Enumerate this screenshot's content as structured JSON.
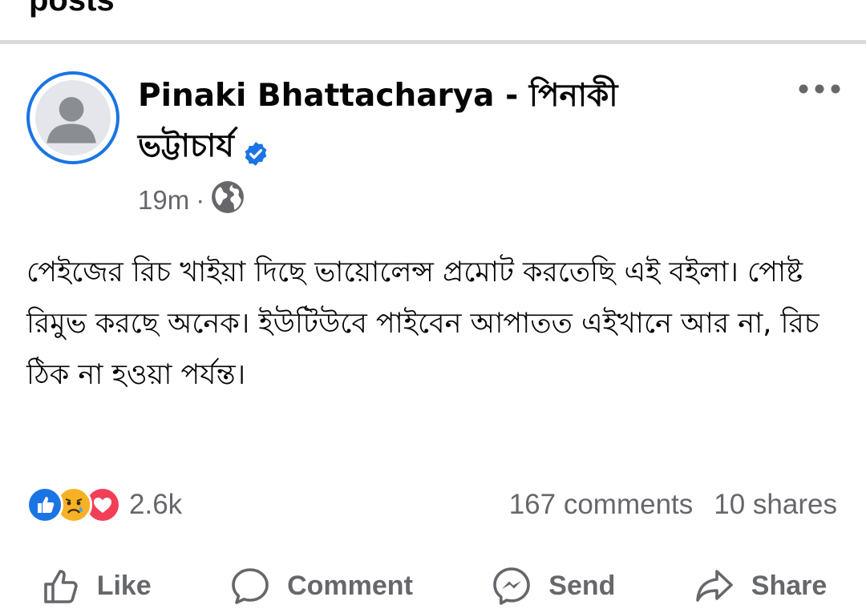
{
  "section": {
    "title": "posts"
  },
  "post": {
    "author": "Pinaki Bhattacharya - পিনাকী ভট্টাচার্য",
    "time": "19m",
    "separator": "·",
    "text": "পেইজের রিচ খাইয়া দিছে ভায়োলেন্স প্রমোট করতেছি এই বইলা। পোষ্ট রিমুভ করছে অনেক। ইউটিউবে পাইবেন আপাতত এইখানে আর না, রিচ ঠিক না হওয়া পর্যন্ত।",
    "reactions_count": "2.6k",
    "comments": "167 comments",
    "shares": "10 shares"
  },
  "actions": {
    "like": "Like",
    "comment": "Comment",
    "send": "Send",
    "share": "Share"
  },
  "icons": {
    "avatar": "default-avatar-icon",
    "verified": "verified-badge-icon",
    "more": "more-options-icon",
    "privacy": "globe-icon",
    "reactions": [
      "like-reaction-icon",
      "care-reaction-icon",
      "love-reaction-icon"
    ]
  },
  "colors": {
    "accent": "#1b74e4",
    "secondary_text": "#65676b",
    "love": "#f33e58",
    "care": "#f7b125"
  }
}
